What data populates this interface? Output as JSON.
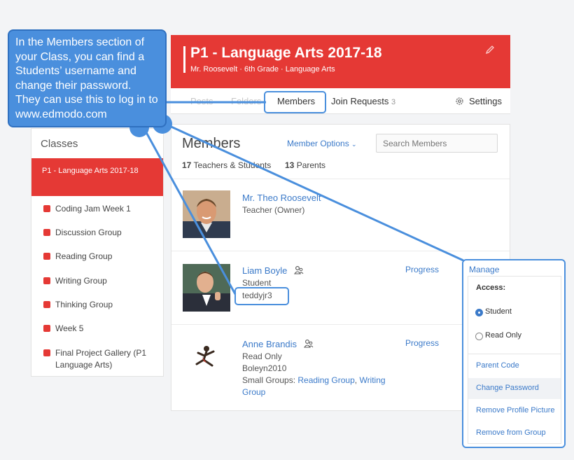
{
  "callout": {
    "text": "In the Members section of your Class, you can find a Students’ username and change their password. They can use this to log in to www.edmodo.com"
  },
  "class_header": {
    "title": "P1 - Language Arts 2017-18",
    "subtitle": "Mr. Roosevelt · 6th Grade · Language Arts"
  },
  "tabs": {
    "posts": "Posts",
    "folders": "Folders",
    "members": "Members",
    "join_requests": "Join Requests",
    "join_requests_count": "3",
    "settings": "Settings"
  },
  "sidebar": {
    "heading": "Classes",
    "active_class": "P1 - Language Arts 2017-18",
    "groups": [
      "Coding Jam Week 1",
      "Discussion Group",
      "Reading Group",
      "Writing Group",
      "Thinking Group",
      "Week 5",
      "Final Project Gallery (P1 Language Arts)"
    ]
  },
  "members": {
    "heading": "Members",
    "options_label": "Member Options",
    "search_placeholder": "Search Members",
    "teachers_students_count": "17",
    "teachers_students_label": "Teachers & Students",
    "parents_count": "13",
    "parents_label": "Parents",
    "list": [
      {
        "name": "Mr. Theo Roosevelt",
        "role": "Teacher (Owner)"
      },
      {
        "name": "Liam Boyle",
        "role": "Student",
        "username": "teddyjr3",
        "progress": "Progress"
      },
      {
        "name": "Anne Brandis",
        "role": "Read Only",
        "username": "Boleyn2010",
        "small_groups_label": "Small Groups:",
        "group_a": "Reading Group",
        "group_sep": ",",
        "group_b_1": "Writing",
        "group_b_2": "Group",
        "progress": "Progress"
      }
    ]
  },
  "manage_menu": {
    "label": "Manage",
    "access_label": "Access:",
    "student_option": "Student",
    "read_only_option": "Read Only",
    "parent_code": "Parent Code",
    "change_password": "Change Password",
    "remove_profile_picture": "Remove Profile Picture",
    "remove_from_group": "Remove from Group"
  },
  "colors": {
    "brand_red": "#e53935",
    "link_blue": "#3b7ac9",
    "callout_blue": "#4a8fdd"
  }
}
